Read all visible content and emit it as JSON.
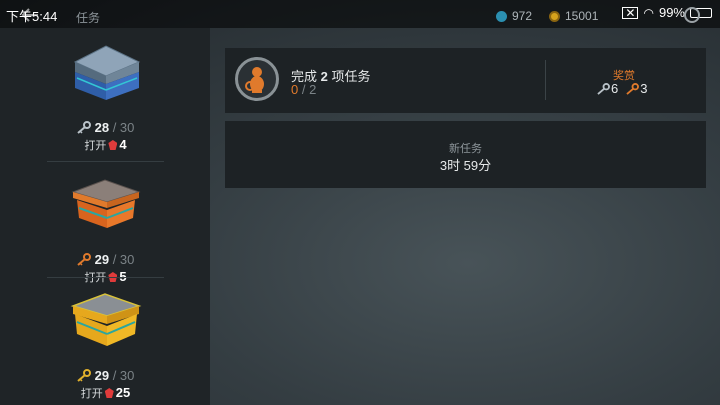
{
  "status_bar": {
    "time": "下午5:44",
    "battery": "99%",
    "battery_level": 0.99
  },
  "header": {
    "title": "任务",
    "currencies": [
      {
        "name": "blue-coin-icon",
        "value": "972",
        "color": "#2b8fb0"
      },
      {
        "name": "gold-coin-icon",
        "value": "15001",
        "color": "#d6a21c"
      }
    ]
  },
  "chests": [
    {
      "name": "silver-chest",
      "key_color": "#b9c2c8",
      "keys": "28",
      "keys_max": "30",
      "open_label": "打开",
      "cost": "4",
      "body_color": "#3d6fc0"
    },
    {
      "name": "bronze-chest",
      "key_color": "#e07a2c",
      "keys": "29",
      "keys_max": "30",
      "open_label": "打开",
      "cost": "5",
      "body_color": "#d8641e"
    },
    {
      "name": "gold-chest",
      "key_color": "#e0b02c",
      "keys": "29",
      "keys_max": "30",
      "open_label": "打开",
      "cost": "25",
      "body_color": "#e6a81d"
    }
  ],
  "task": {
    "title_prefix": "完成",
    "count": "2",
    "title_suffix": "项任务",
    "progress_current": "0",
    "progress_total": "2",
    "reward_label": "奖赏",
    "reward_silver_keys": "6",
    "reward_bronze_keys": "3"
  },
  "new_task": {
    "label": "新任务",
    "time": "3时 59分"
  }
}
